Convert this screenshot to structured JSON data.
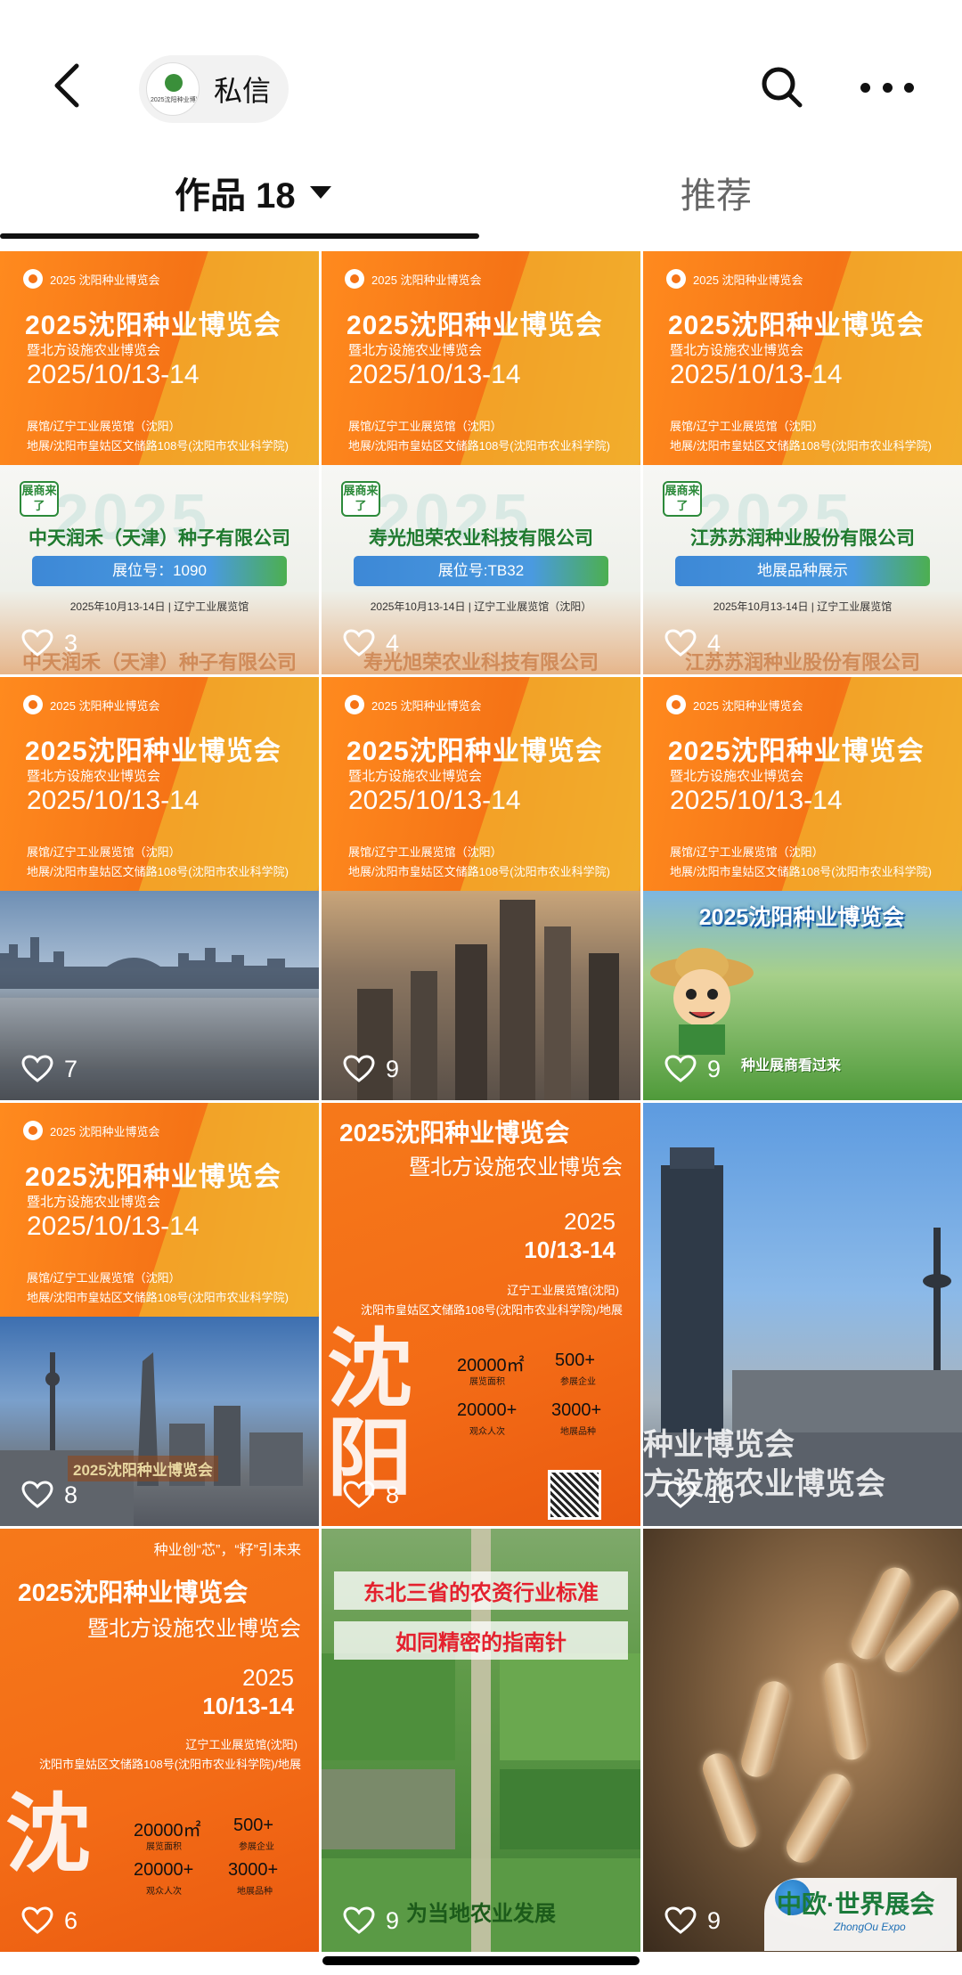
{
  "header": {
    "profile_label": "私信",
    "avatar_text": "2025沈阳种业博览会"
  },
  "tabs": {
    "works_label": "作品 18",
    "recommend_label": "推荐"
  },
  "poster": {
    "logo": "2025 沈阳种业博览会",
    "title": "2025沈阳种业博览会",
    "subtitle": "暨北方设施农业博览会",
    "date": "2025/10/13-14",
    "venue": "展馆/辽宁工业展览馆（沈阳）",
    "address": "地展/沈阳市皇姑区文储路108号(沈阳市农业科学院)"
  },
  "items": [
    {
      "likes": "3",
      "company": "中天润禾（天津）种子有限公司",
      "booth": "展位号：1090",
      "dates": "2025年10月13-14日 | 辽宁工业展览馆",
      "badge": "展商来了",
      "year_ghost": "2025"
    },
    {
      "likes": "4",
      "company": "寿光旭荣农业科技有限公司",
      "booth": "展位号:TB32",
      "dates": "2025年10月13-14日 | 辽宁工业展览馆（沈阳）",
      "badge": "展商来了",
      "year_ghost": "2025"
    },
    {
      "likes": "4",
      "company": "江苏苏润种业股份有限公司",
      "booth": "地展品种展示",
      "dates": "2025年10月13-14日 | 辽宁工业展览馆",
      "badge": "展商来了",
      "year_ghost": "2025"
    },
    {
      "likes": "7"
    },
    {
      "likes": "9"
    },
    {
      "likes": "9",
      "banner": "2025沈阳种业博览会",
      "caption": "种业展商看过来"
    },
    {
      "likes": "8",
      "caption": "2025沈阳种业博览会"
    },
    {
      "likes": "8",
      "title": "2025沈阳种业博览会",
      "subtitle": "暨北方设施农业博览会",
      "year": "2025",
      "date": "10/13-14",
      "venue": "辽宁工业展览馆(沈阳)",
      "address": "沈阳市皇姑区文储路108号(沈阳市农业科学院)/地展",
      "big_char": "沈阳",
      "stat1": "20000㎡",
      "stat1_label": "展览面积",
      "stat2": "500+",
      "stat2_label": "参展企业",
      "stat3": "20000+",
      "stat3_label": "观众人次",
      "stat4": "3000+",
      "stat4_label": "地展品种"
    },
    {
      "likes": "10",
      "caption_line1": "种业博览会",
      "caption_line2": "方设施农业博览会"
    },
    {
      "likes": "6",
      "slogan": "种业创“芯”，“籽”引未来",
      "title": "2025沈阳种业博览会",
      "subtitle": "暨北方设施农业博览会",
      "year": "2025",
      "date": "10/13-14",
      "venue": "辽宁工业展览馆(沈阳)",
      "address": "沈阳市皇姑区文储路108号(沈阳市农业科学院)/地展",
      "big_char": "沈",
      "stat1": "20000㎡",
      "stat1_label": "展览面积",
      "stat2": "500+",
      "stat2_label": "参展企业",
      "stat3": "20000+",
      "stat3_label": "观众人次",
      "stat4": "3000+",
      "stat4_label": "地展品种"
    },
    {
      "likes": "9",
      "title_line1": "东北三省的农资行业标准",
      "title_line2": "如同精密的指南针",
      "bottom_text": "为当地农业发展"
    },
    {
      "likes": "9",
      "watermark": "中欧·世界展会",
      "watermark_sub": "ZhongOu Expo"
    }
  ]
}
